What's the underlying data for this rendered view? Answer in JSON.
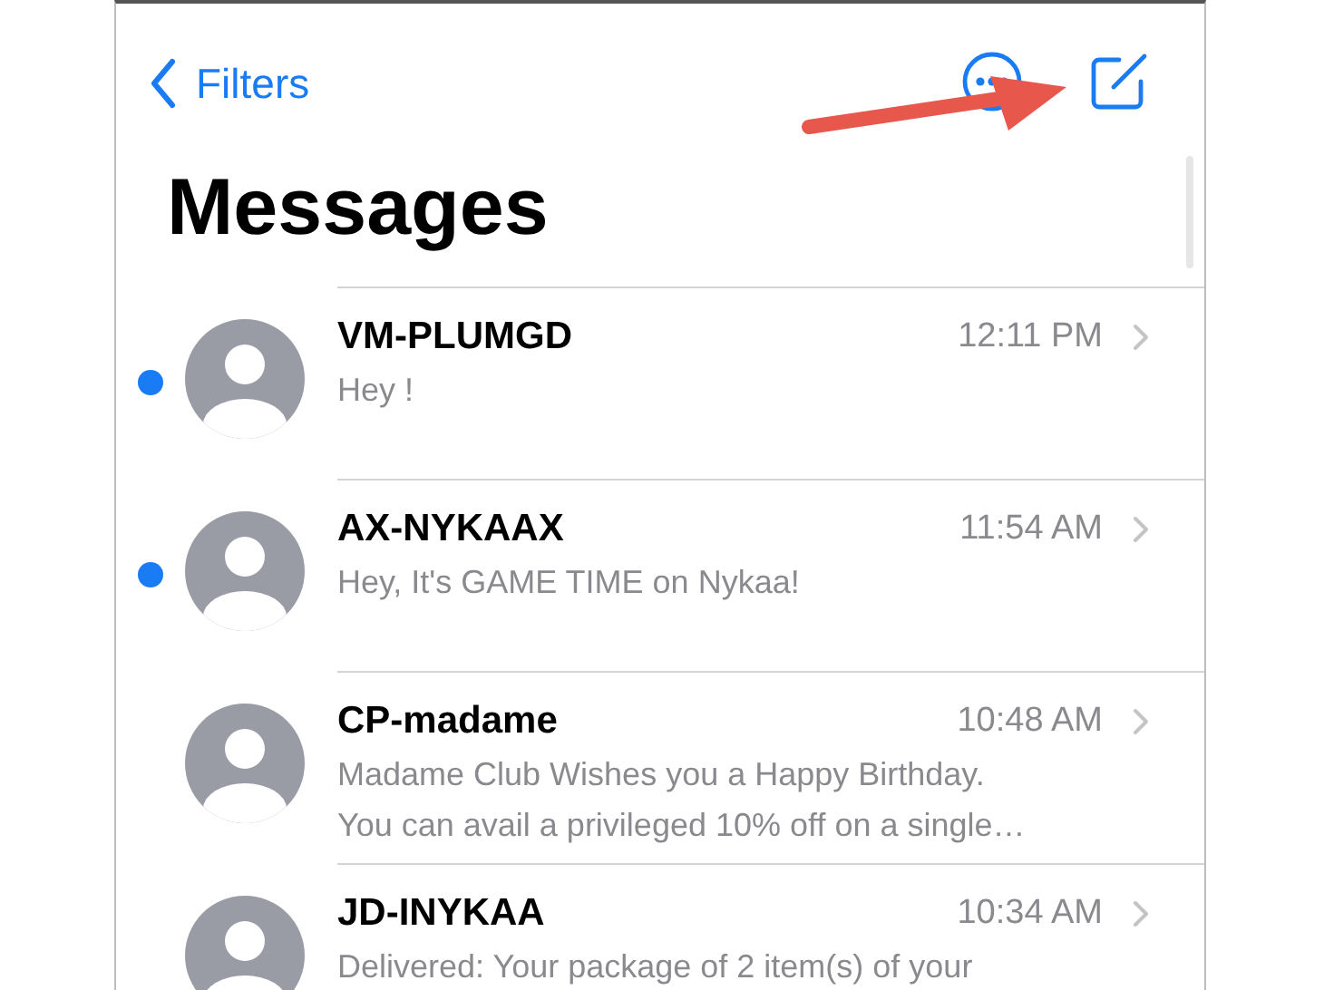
{
  "nav": {
    "back_label": "Filters"
  },
  "title": "Messages",
  "conversations": [
    {
      "name": "VM-PLUMGD",
      "time": "12:11 PM",
      "unread": true,
      "preview_lines": [
        "Hey !"
      ]
    },
    {
      "name": "AX-NYKAAX",
      "time": "11:54 AM",
      "unread": true,
      "preview_lines": [
        "Hey, It's GAME TIME on Nykaa!"
      ]
    },
    {
      "name": "CP-madame",
      "time": "10:48 AM",
      "unread": false,
      "preview_lines": [
        "Madame Club Wishes you a Happy Birthday.",
        "You can avail a privileged 10% off on a single…"
      ]
    },
    {
      "name": "JD-INYKAA",
      "time": "10:34 AM",
      "unread": false,
      "preview_lines": [
        "Delivered: Your package of 2 item(s) of your"
      ]
    }
  ]
}
